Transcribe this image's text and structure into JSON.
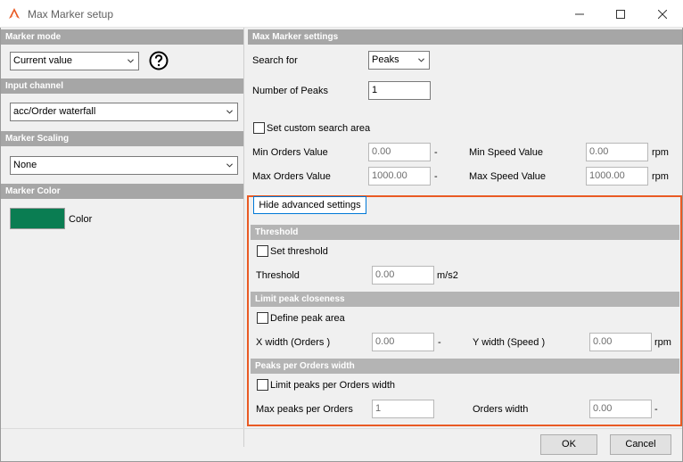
{
  "window": {
    "title": "Max Marker setup",
    "app_icon": "dewesoft-logo-icon",
    "accent_color": "#e95a24",
    "minimize_icon": "minimize-icon",
    "maximize_icon": "maximize-icon",
    "close_icon": "close-icon"
  },
  "left": {
    "marker_mode": {
      "header": "Marker mode",
      "value": "Current value",
      "help_icon": "help-icon"
    },
    "input_channel": {
      "header": "Input channel",
      "value": "acc/Order waterfall"
    },
    "marker_scaling": {
      "header": "Marker Scaling",
      "value": "None"
    },
    "marker_color": {
      "header": "Marker Color",
      "label": "Color",
      "swatch": "#0a7d52"
    }
  },
  "max_marker": {
    "header": "Max Marker settings",
    "search_for_label": "Search for",
    "search_for_value": "Peaks",
    "num_peaks_label": "Number of Peaks",
    "num_peaks_value": "1",
    "custom_area_label": "Set custom search area",
    "min_orders_label": "Min Orders Value",
    "min_orders_value": "0.00",
    "min_orders_unit": "-",
    "max_orders_label": "Max Orders Value",
    "max_orders_value": "1000.00",
    "max_orders_unit": "-",
    "min_speed_label": "Min Speed Value",
    "min_speed_value": "0.00",
    "min_speed_unit": "rpm",
    "max_speed_label": "Max Speed Value",
    "max_speed_value": "1000.00",
    "max_speed_unit": "rpm"
  },
  "advanced": {
    "toggle_label": "Hide advanced settings",
    "threshold": {
      "header": "Threshold",
      "checkbox_label": "Set threshold",
      "label": "Threshold",
      "value": "0.00",
      "unit": "m/s2"
    },
    "closeness": {
      "header": "Limit peak closeness",
      "checkbox_label": "Define peak area",
      "x_width_label": "X width (Orders )",
      "x_width_value": "0.00",
      "x_width_unit": "-",
      "y_width_label": "Y width (Speed )",
      "y_width_value": "0.00",
      "y_width_unit": "rpm"
    },
    "peaks_per_width": {
      "header": "Peaks per Orders width",
      "checkbox_label": "Limit peaks per Orders width",
      "max_peaks_label": "Max peaks per Orders",
      "max_peaks_value": "1",
      "orders_width_label": "Orders width",
      "orders_width_value": "0.00",
      "orders_width_unit": "-"
    }
  },
  "footer": {
    "ok_label": "OK",
    "cancel_label": "Cancel"
  }
}
